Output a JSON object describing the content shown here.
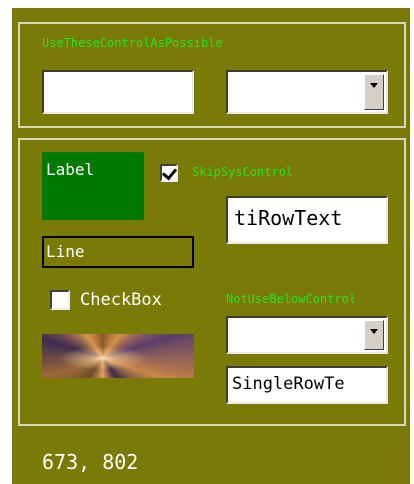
{
  "group1": {
    "caption": "UseTheseControlAsPossible",
    "textbox_value": "",
    "combo_value": ""
  },
  "group2": {
    "label_text": "Label",
    "skip_checkbox": {
      "label": "SkipSysControl",
      "checked": true
    },
    "multirow_text": "tiRowText",
    "line_text": "Line",
    "checkbox": {
      "label": "CheckBox",
      "checked": false
    },
    "notuse_caption": "NotUseBelowControl",
    "combo_value": "",
    "singlerow_text": "SingleRowTe"
  },
  "status": {
    "coords": "673, 802"
  },
  "colors": {
    "panel_bg": "#7a7a06",
    "caption_green": "#22e522",
    "label_bg": "#007a00",
    "group_border": "#d8d8b4"
  },
  "icons": {
    "combo_arrow": "chevron-down-icon",
    "check": "check-icon"
  }
}
